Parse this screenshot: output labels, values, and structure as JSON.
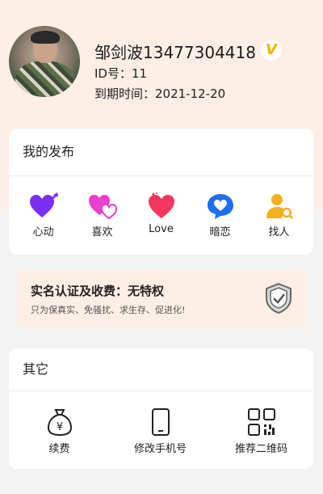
{
  "profile": {
    "name": "邹剑波13477304418",
    "vip_badge": "V",
    "id_line": "ID号：11",
    "expiry_line": "到期时间：2021-12-20"
  },
  "publish": {
    "title": "我的发布",
    "items": [
      {
        "label": "心动",
        "icon": "heart-arrow-icon",
        "color": "#7b2ff2"
      },
      {
        "label": "喜欢",
        "icon": "two-hearts-icon",
        "color": "#e93fd0"
      },
      {
        "label": "Love",
        "icon": "heart-icon",
        "color": "#f2385f"
      },
      {
        "label": "暗恋",
        "icon": "heart-bubble-icon",
        "color": "#1e6ff0"
      },
      {
        "label": "找人",
        "icon": "person-search-icon",
        "color": "#f5b021"
      }
    ]
  },
  "auth": {
    "title": "实名认证及收费：无特权",
    "subtitle": "只为保真实、免骚扰、求生存、促进化!",
    "icon": "shield-check-icon"
  },
  "other": {
    "title": "其它",
    "items": [
      {
        "label": "续费",
        "icon": "money-bag-icon"
      },
      {
        "label": "修改手机号",
        "icon": "phone-icon"
      },
      {
        "label": "推荐二维码",
        "icon": "qr-code-icon"
      }
    ]
  },
  "colors": {
    "top_background": "#fdeee6",
    "page_background": "#f3f3f3",
    "vip_gold": "#e5b700"
  }
}
